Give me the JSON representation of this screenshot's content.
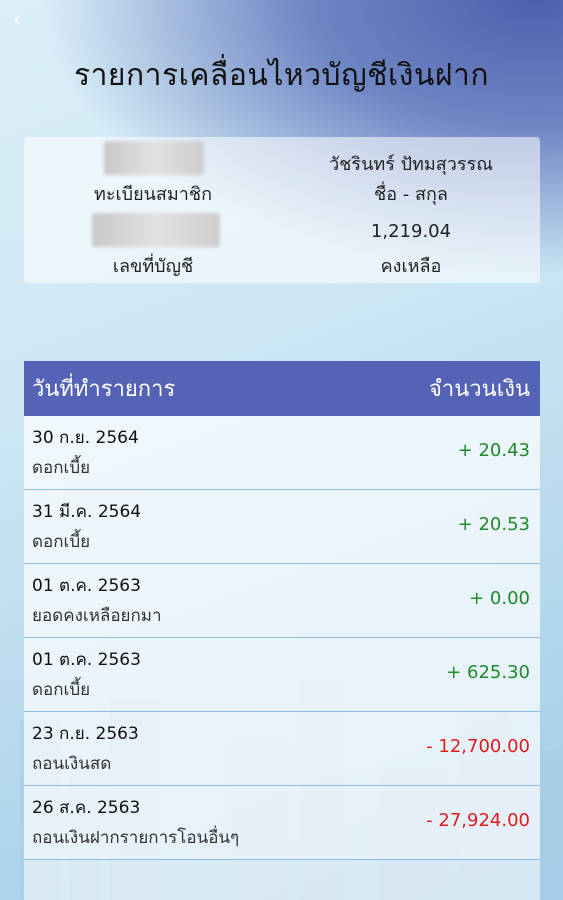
{
  "header": {
    "back_icon": "chevron-left-icon",
    "title": "รายการเคลื่อนไหวบัญชีเงินฝาก"
  },
  "info": {
    "member_id_label": "ทะเบียนสมาชิก",
    "name_value": "วัชรินทร์ ปัทมสุวรรณ",
    "name_label": "ชื่อ - สกุล",
    "account_label": "เลขที่บัญชี",
    "balance_value": "1,219.04",
    "balance_label": "คงเหลือ"
  },
  "table": {
    "col_date": "วันที่ทำรายการ",
    "col_amount": "จำนวนเงิน",
    "rows": [
      {
        "date": "30 ก.ย. 2564",
        "desc": "ดอกเบี้ย",
        "amount": "+ 20.43",
        "type": "pos"
      },
      {
        "date": "31 มี.ค. 2564",
        "desc": "ดอกเบี้ย",
        "amount": "+ 20.53",
        "type": "pos"
      },
      {
        "date": "01 ต.ค. 2563",
        "desc": "ยอดคงเหลือยกมา",
        "amount": "+ 0.00",
        "type": "pos"
      },
      {
        "date": "01 ต.ค. 2563",
        "desc": "ดอกเบี้ย",
        "amount": "+ 625.30",
        "type": "pos"
      },
      {
        "date": "23 ก.ย. 2563",
        "desc": "ถอนเงินสด",
        "amount": "- 12,700.00",
        "type": "neg"
      },
      {
        "date": "26 ส.ค. 2563",
        "desc": "ถอนเงินฝากรายการโอนอื่นๆ",
        "amount": "- 27,924.00",
        "type": "neg"
      }
    ]
  },
  "colors": {
    "header_bg": "#5463b5",
    "positive": "#1f8a2b",
    "negative": "#e21b1b"
  }
}
